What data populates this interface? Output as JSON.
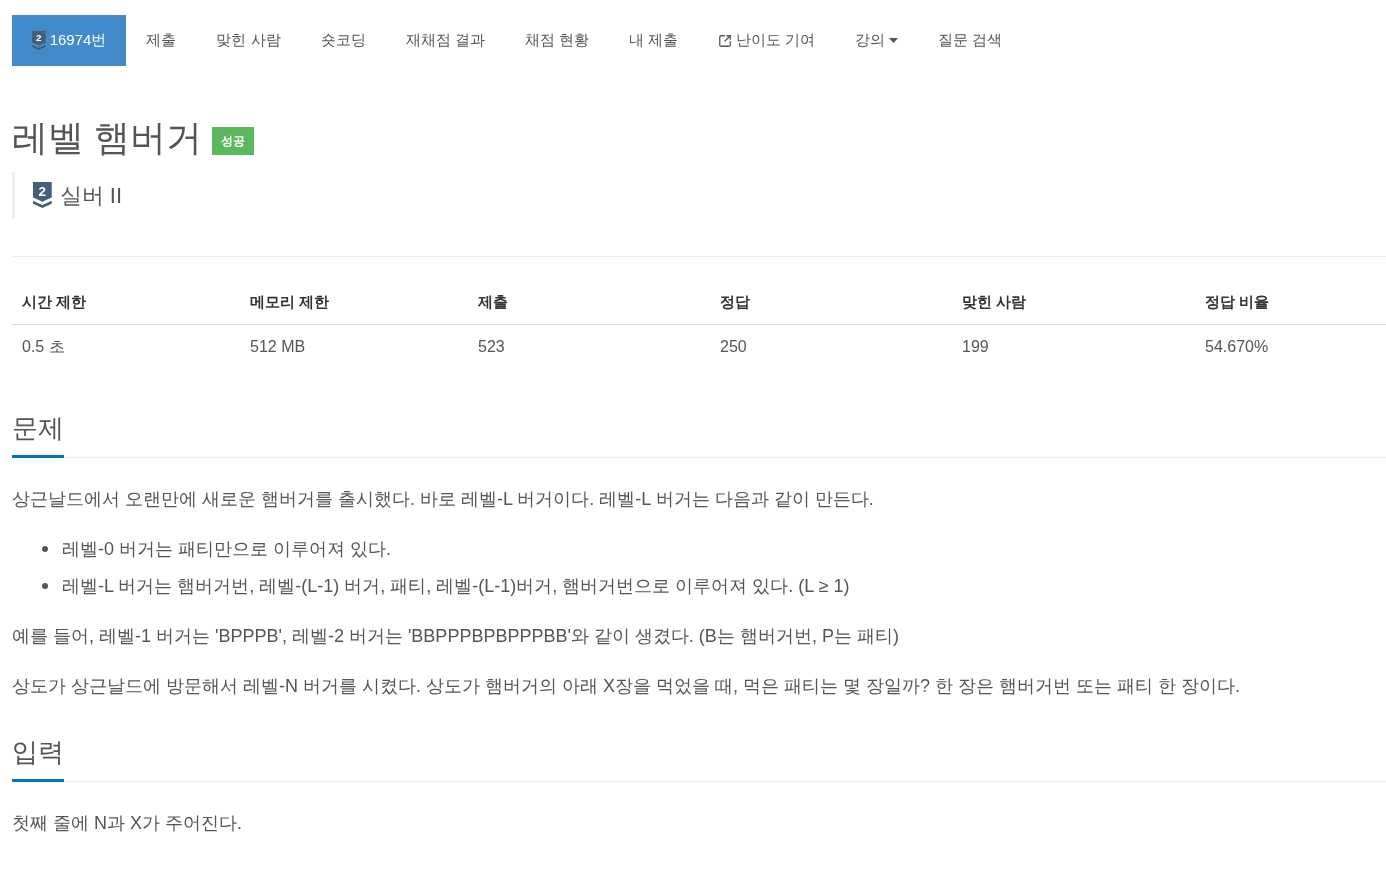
{
  "nav": {
    "items": [
      {
        "kind": "problem",
        "label": "16974번",
        "badge_number": "2",
        "selected": true
      },
      {
        "kind": "link",
        "label": "제출",
        "selected": false
      },
      {
        "kind": "link",
        "label": "맞힌 사람",
        "selected": false
      },
      {
        "kind": "link",
        "label": "숏코딩",
        "selected": false
      },
      {
        "kind": "link",
        "label": "재채점 결과",
        "selected": false
      },
      {
        "kind": "link",
        "label": "채점 현황",
        "selected": false
      },
      {
        "kind": "link",
        "label": "내 제출",
        "selected": false
      },
      {
        "kind": "external",
        "label": "난이도 기여",
        "selected": false
      },
      {
        "kind": "dropdown",
        "label": "강의",
        "selected": false
      },
      {
        "kind": "link",
        "label": "질문 검색",
        "selected": false
      }
    ]
  },
  "problem": {
    "title": "레벨 햄버거",
    "status_label": "성공",
    "tier": {
      "number": "2",
      "name": "실버 II"
    }
  },
  "info_table": {
    "columns": [
      "시간 제한",
      "메모리 제한",
      "제출",
      "정답",
      "맞힌 사람",
      "정답 비율"
    ],
    "rows": [
      [
        "0.5 초",
        "512 MB",
        "523",
        "250",
        "199",
        "54.670%"
      ]
    ]
  },
  "sections": [
    {
      "heading": "문제",
      "blocks": [
        {
          "kind": "paragraph",
          "text": "상근날드에서 오랜만에 새로운 햄버거를 출시했다. 바로 레벨-L 버거이다. 레벨-L 버거는 다음과 같이 만든다."
        },
        {
          "kind": "list",
          "items": [
            "레벨-0 버거는 패티만으로 이루어져 있다.",
            "레벨-L 버거는 햄버거번, 레벨-(L-1) 버거, 패티, 레벨-(L-1)버거, 햄버거번으로 이루어져 있다. (L ≥ 1)"
          ]
        },
        {
          "kind": "paragraph",
          "text": "예를 들어, 레벨-1 버거는 'BPPPB', 레벨-2 버거는 'BBPPPBPBPPPBB'와 같이 생겼다. (B는 햄버거번, P는 패티)"
        },
        {
          "kind": "paragraph",
          "text": "상도가 상근날드에 방문해서 레벨-N 버거를 시켰다. 상도가 햄버거의 아래 X장을 먹었을 때, 먹은 패티는 몇 장일까? 한 장은 햄버거번 또는 패티 한 장이다."
        }
      ]
    },
    {
      "heading": "입력",
      "blocks": [
        {
          "kind": "paragraph",
          "text": "첫째 줄에 N과 X가 주어진다."
        }
      ]
    }
  ]
}
